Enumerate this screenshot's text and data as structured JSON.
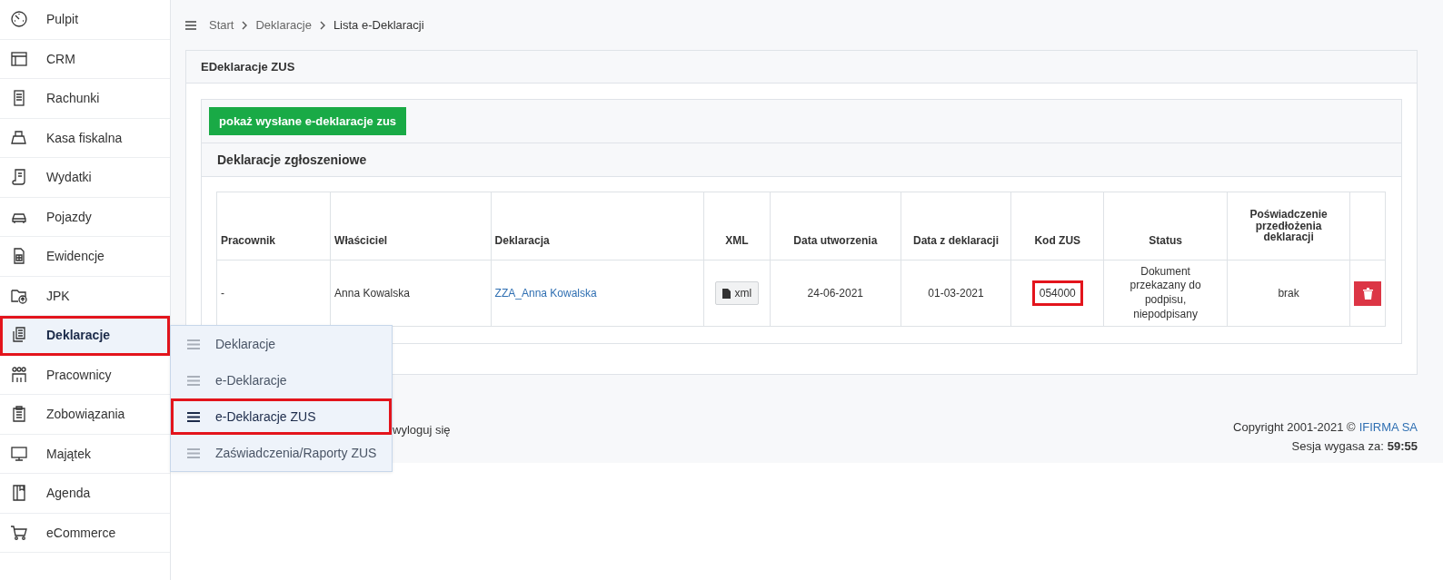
{
  "sidebar": {
    "items": [
      {
        "label": "Pulpit",
        "selected": false,
        "highlighted": false
      },
      {
        "label": "CRM",
        "selected": false,
        "highlighted": false
      },
      {
        "label": "Rachunki",
        "selected": false,
        "highlighted": false
      },
      {
        "label": "Kasa fiskalna",
        "selected": false,
        "highlighted": false
      },
      {
        "label": "Wydatki",
        "selected": false,
        "highlighted": false
      },
      {
        "label": "Pojazdy",
        "selected": false,
        "highlighted": false
      },
      {
        "label": "Ewidencje",
        "selected": false,
        "highlighted": false
      },
      {
        "label": "JPK",
        "selected": false,
        "highlighted": false
      },
      {
        "label": "Deklaracje",
        "selected": true,
        "highlighted": true
      },
      {
        "label": "Pracownicy",
        "selected": false,
        "highlighted": false
      },
      {
        "label": "Zobowiązania",
        "selected": false,
        "highlighted": false
      },
      {
        "label": "Majątek",
        "selected": false,
        "highlighted": false
      },
      {
        "label": "Agenda",
        "selected": false,
        "highlighted": false
      },
      {
        "label": "eCommerce",
        "selected": false,
        "highlighted": false
      }
    ]
  },
  "submenu": {
    "items": [
      {
        "label": "Deklaracje",
        "selected": false,
        "highlighted": false
      },
      {
        "label": "e-Deklaracje",
        "selected": false,
        "highlighted": false
      },
      {
        "label": "e-Deklaracje ZUS",
        "selected": true,
        "highlighted": true
      },
      {
        "label": "Zaświadczenia/Raporty ZUS",
        "selected": false,
        "highlighted": false
      }
    ]
  },
  "breadcrumb": [
    "Start",
    "Deklaracje",
    "Lista e-Deklaracji"
  ],
  "card": {
    "title": "EDeklaracje ZUS",
    "show_sent_button": "pokaż wysłane e-deklaracje zus",
    "section_title": "Deklaracje zgłoszeniowe",
    "table": {
      "columns": [
        "Pracownik",
        "Właściciel",
        "Deklaracja",
        "XML",
        "Data utworzenia",
        "Data z deklaracji",
        "Kod ZUS",
        "Status",
        "Poświadczenie przedłożenia deklaracji"
      ],
      "rows": [
        {
          "pracownik": "-",
          "wlasciciel": "Anna Kowalska",
          "deklaracja": "ZZA_Anna Kowalska",
          "xml": "xml",
          "data_utworzenia": "24-06-2021",
          "data_z_deklaracji": "01-03-2021",
          "kod_zus": "054000",
          "kod_zus_highlighted": true,
          "status": "Dokument przekazany do podpisu, niepodpisany",
          "poswiadczenie": "brak"
        }
      ]
    }
  },
  "footer": {
    "logout": "wyloguj się",
    "copyright": "Copyright 2001-2021 ©",
    "company": "IFIRMA SA",
    "session_label": "Sesja wygasa za:",
    "session_time": "59:55"
  }
}
